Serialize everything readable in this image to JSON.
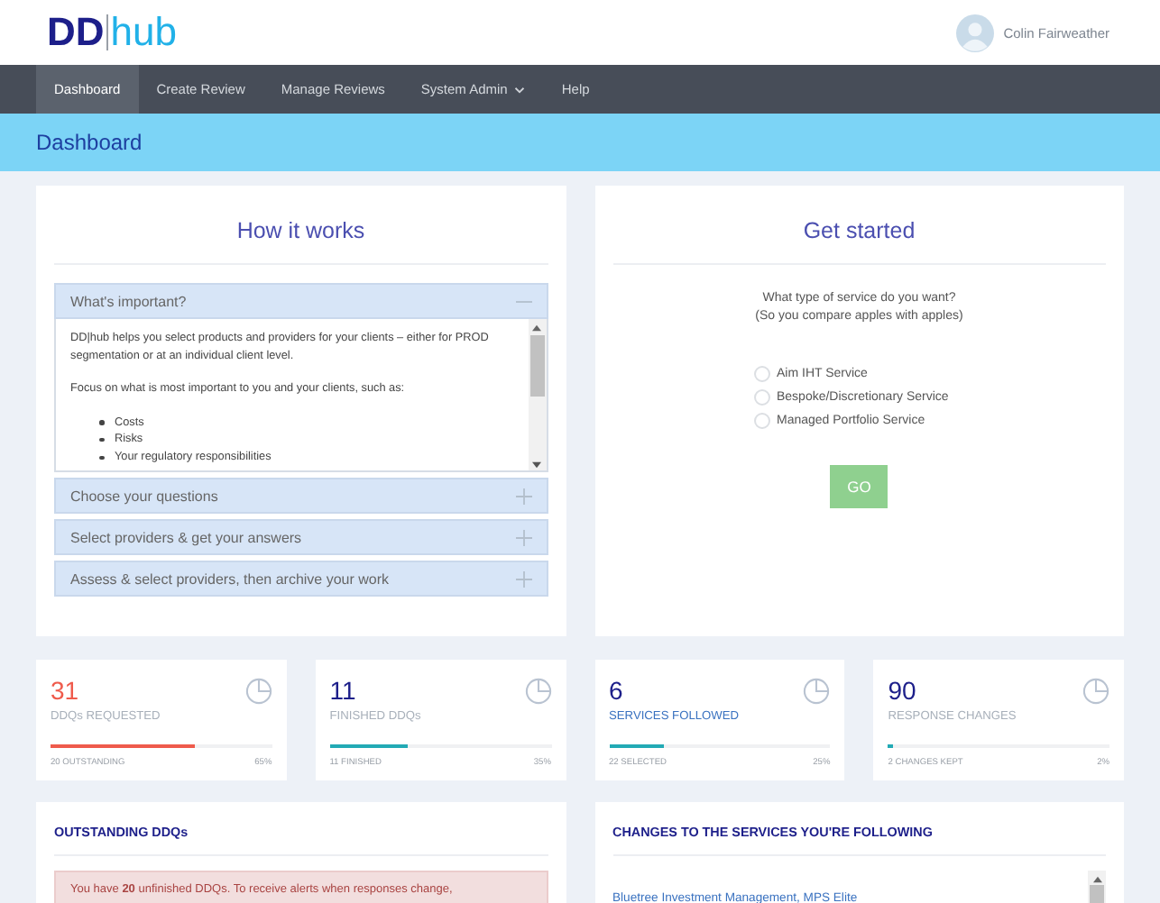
{
  "logo": {
    "left": "DD",
    "right": "hub"
  },
  "user": {
    "name": "Colin Fairweather"
  },
  "nav": [
    {
      "label": "Dashboard",
      "selected": true,
      "has_menu": false
    },
    {
      "label": "Create Review",
      "selected": false,
      "has_menu": false
    },
    {
      "label": "Manage Reviews",
      "selected": false,
      "has_menu": false
    },
    {
      "label": "System Admin",
      "selected": false,
      "has_menu": true
    },
    {
      "label": "Help",
      "selected": false,
      "has_menu": false
    }
  ],
  "page_title": "Dashboard",
  "how_it_works": {
    "title": "How it works",
    "items": [
      {
        "title": "What's important?",
        "expanded": true,
        "paragraphs": [
          "DD|hub helps you select products and providers for your clients – either for PROD segmentation or at an individual client level.",
          "Focus on what is most important to you and your clients, such as:"
        ],
        "bullets": [
          "Costs",
          "Risks",
          "Your regulatory responsibilities"
        ]
      },
      {
        "title": "Choose your questions",
        "expanded": false
      },
      {
        "title": "Select providers & get your answers",
        "expanded": false
      },
      {
        "title": "Assess & select providers, then archive your work",
        "expanded": false
      }
    ]
  },
  "get_started": {
    "title": "Get started",
    "question": [
      "What type of service do you want?",
      "(So you compare apples with apples)"
    ],
    "options": [
      {
        "label": "Aim IHT Service",
        "selected": false
      },
      {
        "label": "Bespoke/Discretionary Service",
        "selected": false
      },
      {
        "label": "Managed Portfolio Service",
        "selected": false
      }
    ],
    "button": "GO"
  },
  "stats": [
    {
      "value": "31",
      "label": "DDQs REQUESTED",
      "kind": "alert",
      "footer": "20 OUTSTANDING",
      "percent": "65%",
      "level": 0.65,
      "color": "#ef5b4c"
    },
    {
      "value": "11",
      "label": "FINISHED DDQs",
      "kind": "plain",
      "footer": "11 FINISHED",
      "percent": "35%",
      "level": 0.35,
      "color": "#22aab5"
    },
    {
      "value": "6",
      "label": "SERVICES FOLLOWED",
      "kind": "link",
      "footer": "22 SELECTED",
      "percent": "25%",
      "level": 0.25,
      "color": "#22aab5"
    },
    {
      "value": "90",
      "label": "RESPONSE CHANGES",
      "kind": "plain",
      "footer": "2 CHANGES KEPT",
      "percent": "2%",
      "level": 0.02,
      "color": "#22aab5"
    }
  ],
  "outstanding": {
    "title": "OUTSTANDING DDQs",
    "alert": "You have **20** unfinished DDQs. To receive alerts when responses change,"
  },
  "changes": {
    "title": "CHANGES TO THE SERVICES YOU'RE FOLLOWING",
    "links": [
      "Bluetree Investment Management, MPS Elite"
    ]
  }
}
